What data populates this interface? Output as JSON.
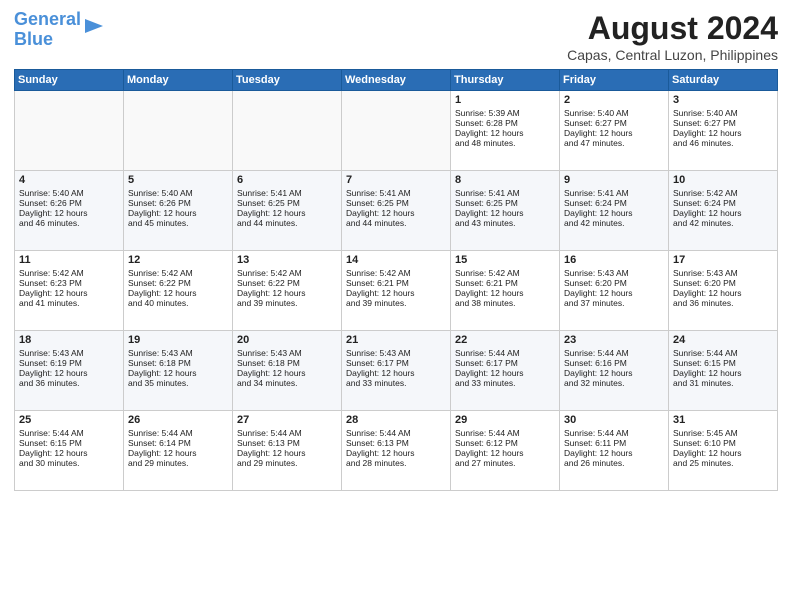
{
  "logo": {
    "line1": "General",
    "line2": "Blue"
  },
  "title": "August 2024",
  "location": "Capas, Central Luzon, Philippines",
  "days_of_week": [
    "Sunday",
    "Monday",
    "Tuesday",
    "Wednesday",
    "Thursday",
    "Friday",
    "Saturday"
  ],
  "weeks": [
    [
      {
        "day": "",
        "content": ""
      },
      {
        "day": "",
        "content": ""
      },
      {
        "day": "",
        "content": ""
      },
      {
        "day": "",
        "content": ""
      },
      {
        "day": "1",
        "content": "Sunrise: 5:39 AM\nSunset: 6:28 PM\nDaylight: 12 hours\nand 48 minutes."
      },
      {
        "day": "2",
        "content": "Sunrise: 5:40 AM\nSunset: 6:27 PM\nDaylight: 12 hours\nand 47 minutes."
      },
      {
        "day": "3",
        "content": "Sunrise: 5:40 AM\nSunset: 6:27 PM\nDaylight: 12 hours\nand 46 minutes."
      }
    ],
    [
      {
        "day": "4",
        "content": "Sunrise: 5:40 AM\nSunset: 6:26 PM\nDaylight: 12 hours\nand 46 minutes."
      },
      {
        "day": "5",
        "content": "Sunrise: 5:40 AM\nSunset: 6:26 PM\nDaylight: 12 hours\nand 45 minutes."
      },
      {
        "day": "6",
        "content": "Sunrise: 5:41 AM\nSunset: 6:25 PM\nDaylight: 12 hours\nand 44 minutes."
      },
      {
        "day": "7",
        "content": "Sunrise: 5:41 AM\nSunset: 6:25 PM\nDaylight: 12 hours\nand 44 minutes."
      },
      {
        "day": "8",
        "content": "Sunrise: 5:41 AM\nSunset: 6:25 PM\nDaylight: 12 hours\nand 43 minutes."
      },
      {
        "day": "9",
        "content": "Sunrise: 5:41 AM\nSunset: 6:24 PM\nDaylight: 12 hours\nand 42 minutes."
      },
      {
        "day": "10",
        "content": "Sunrise: 5:42 AM\nSunset: 6:24 PM\nDaylight: 12 hours\nand 42 minutes."
      }
    ],
    [
      {
        "day": "11",
        "content": "Sunrise: 5:42 AM\nSunset: 6:23 PM\nDaylight: 12 hours\nand 41 minutes."
      },
      {
        "day": "12",
        "content": "Sunrise: 5:42 AM\nSunset: 6:22 PM\nDaylight: 12 hours\nand 40 minutes."
      },
      {
        "day": "13",
        "content": "Sunrise: 5:42 AM\nSunset: 6:22 PM\nDaylight: 12 hours\nand 39 minutes."
      },
      {
        "day": "14",
        "content": "Sunrise: 5:42 AM\nSunset: 6:21 PM\nDaylight: 12 hours\nand 39 minutes."
      },
      {
        "day": "15",
        "content": "Sunrise: 5:42 AM\nSunset: 6:21 PM\nDaylight: 12 hours\nand 38 minutes."
      },
      {
        "day": "16",
        "content": "Sunrise: 5:43 AM\nSunset: 6:20 PM\nDaylight: 12 hours\nand 37 minutes."
      },
      {
        "day": "17",
        "content": "Sunrise: 5:43 AM\nSunset: 6:20 PM\nDaylight: 12 hours\nand 36 minutes."
      }
    ],
    [
      {
        "day": "18",
        "content": "Sunrise: 5:43 AM\nSunset: 6:19 PM\nDaylight: 12 hours\nand 36 minutes."
      },
      {
        "day": "19",
        "content": "Sunrise: 5:43 AM\nSunset: 6:18 PM\nDaylight: 12 hours\nand 35 minutes."
      },
      {
        "day": "20",
        "content": "Sunrise: 5:43 AM\nSunset: 6:18 PM\nDaylight: 12 hours\nand 34 minutes."
      },
      {
        "day": "21",
        "content": "Sunrise: 5:43 AM\nSunset: 6:17 PM\nDaylight: 12 hours\nand 33 minutes."
      },
      {
        "day": "22",
        "content": "Sunrise: 5:44 AM\nSunset: 6:17 PM\nDaylight: 12 hours\nand 33 minutes."
      },
      {
        "day": "23",
        "content": "Sunrise: 5:44 AM\nSunset: 6:16 PM\nDaylight: 12 hours\nand 32 minutes."
      },
      {
        "day": "24",
        "content": "Sunrise: 5:44 AM\nSunset: 6:15 PM\nDaylight: 12 hours\nand 31 minutes."
      }
    ],
    [
      {
        "day": "25",
        "content": "Sunrise: 5:44 AM\nSunset: 6:15 PM\nDaylight: 12 hours\nand 30 minutes."
      },
      {
        "day": "26",
        "content": "Sunrise: 5:44 AM\nSunset: 6:14 PM\nDaylight: 12 hours\nand 29 minutes."
      },
      {
        "day": "27",
        "content": "Sunrise: 5:44 AM\nSunset: 6:13 PM\nDaylight: 12 hours\nand 29 minutes."
      },
      {
        "day": "28",
        "content": "Sunrise: 5:44 AM\nSunset: 6:13 PM\nDaylight: 12 hours\nand 28 minutes."
      },
      {
        "day": "29",
        "content": "Sunrise: 5:44 AM\nSunset: 6:12 PM\nDaylight: 12 hours\nand 27 minutes."
      },
      {
        "day": "30",
        "content": "Sunrise: 5:44 AM\nSunset: 6:11 PM\nDaylight: 12 hours\nand 26 minutes."
      },
      {
        "day": "31",
        "content": "Sunrise: 5:45 AM\nSunset: 6:10 PM\nDaylight: 12 hours\nand 25 minutes."
      }
    ]
  ]
}
